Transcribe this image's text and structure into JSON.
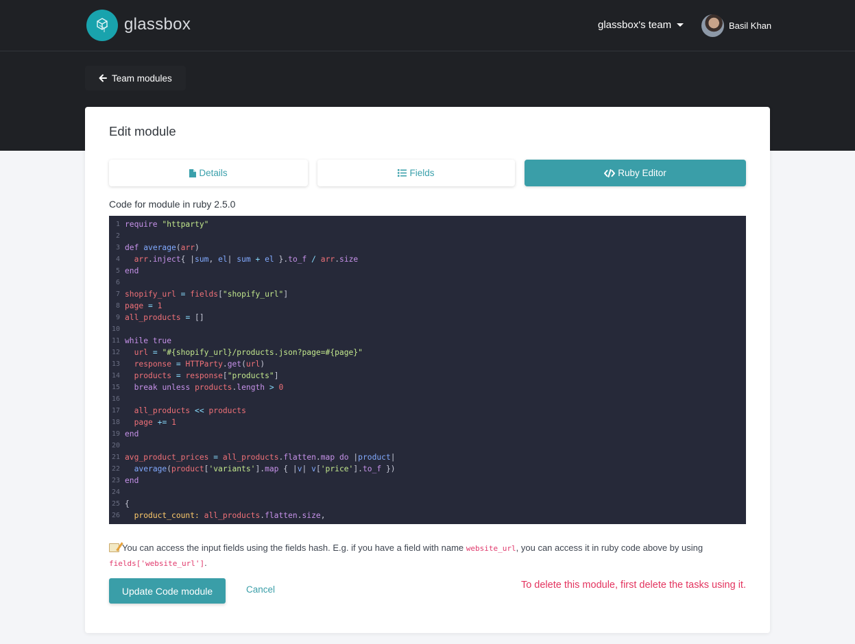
{
  "brand": {
    "name": "glassbox"
  },
  "header": {
    "team_menu": "glassbox's team",
    "user_name": "Basil Khan"
  },
  "back_link": {
    "label": "Team modules"
  },
  "card": {
    "title": "Edit module"
  },
  "tabs": [
    {
      "label": "Details",
      "icon": "file-icon",
      "active": false
    },
    {
      "label": "Fields",
      "icon": "list-icon",
      "active": false
    },
    {
      "label": "Ruby Editor",
      "icon": "code-icon",
      "active": true
    }
  ],
  "editor": {
    "label": "Code for module in ruby 2.5.0",
    "lines": [
      {
        "n": "1",
        "text": "require \"httparty\""
      },
      {
        "n": "2",
        "text": ""
      },
      {
        "n": "3",
        "text": "def average(arr)"
      },
      {
        "n": "4",
        "text": "  arr.inject{ |sum, el| sum + el }.to_f / arr.size"
      },
      {
        "n": "5",
        "text": "end"
      },
      {
        "n": "6",
        "text": ""
      },
      {
        "n": "7",
        "text": "shopify_url = fields[\"shopify_url\"]"
      },
      {
        "n": "8",
        "text": "page = 1"
      },
      {
        "n": "9",
        "text": "all_products = []"
      },
      {
        "n": "10",
        "text": ""
      },
      {
        "n": "11",
        "text": "while true"
      },
      {
        "n": "12",
        "text": "  url = \"#{shopify_url}/products.json?page=#{page}\""
      },
      {
        "n": "13",
        "text": "  response = HTTParty.get(url)"
      },
      {
        "n": "14",
        "text": "  products = response[\"products\"]"
      },
      {
        "n": "15",
        "text": "  break unless products.length > 0"
      },
      {
        "n": "16",
        "text": ""
      },
      {
        "n": "17",
        "text": "  all_products << products"
      },
      {
        "n": "18",
        "text": "  page += 1"
      },
      {
        "n": "19",
        "text": "end"
      },
      {
        "n": "20",
        "text": ""
      },
      {
        "n": "21",
        "text": "avg_product_prices = all_products.flatten.map do |product|"
      },
      {
        "n": "22",
        "text": "  average(product['variants'].map { |v| v['price'].to_f })"
      },
      {
        "n": "23",
        "text": "end"
      },
      {
        "n": "24",
        "text": ""
      },
      {
        "n": "25",
        "text": "{"
      },
      {
        "n": "26",
        "text": "  product_count: all_products.flatten.size,"
      }
    ]
  },
  "hint": {
    "part1": "You can access the input fields using the fields hash. E.g. if you have a field with name",
    "code1": "website_url",
    "part2": ", you can access it in ruby code above by using",
    "code2": "fields['website_url']",
    "part3": "."
  },
  "actions": {
    "update_label": "Update Code module",
    "cancel_label": "Cancel",
    "delete_message": "To delete this module, first delete the tasks using it."
  },
  "colors": {
    "accent": "#3a9ea8",
    "header_bg": "#1f2125",
    "editor_bg": "#262939",
    "danger": "#e3335e"
  }
}
